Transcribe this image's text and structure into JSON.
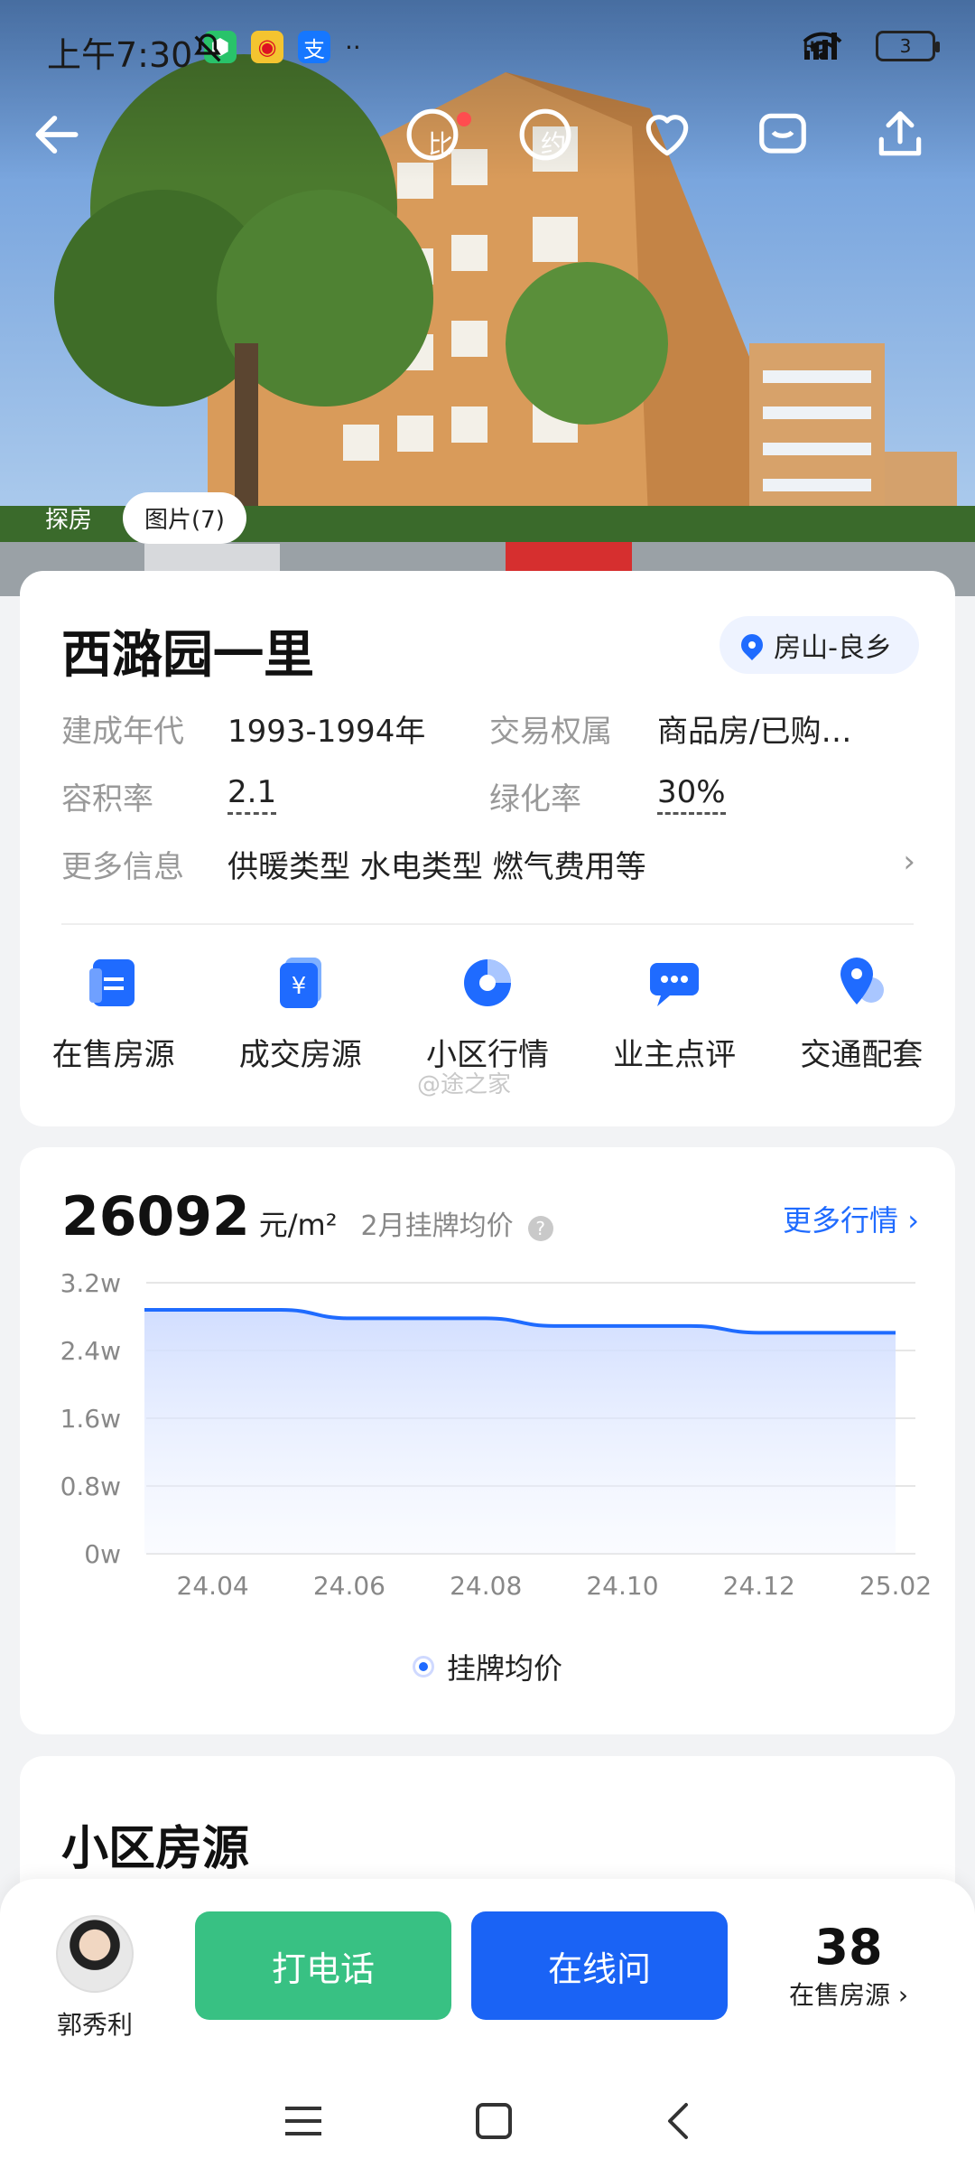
{
  "status_bar": {
    "time": "上午7:30",
    "app_icons": [
      "shield-app",
      "weibo-app",
      "alipay-app"
    ],
    "alipay_char": "支",
    "overflow": "··",
    "network": "HD",
    "battery": "3"
  },
  "photo": {
    "tabs": [
      "探房",
      "图片(7)"
    ]
  },
  "nav": {
    "icons": [
      "back-arrow-icon",
      "compare-icon",
      "calendar-icon",
      "favorite-icon",
      "message-icon",
      "share-icon"
    ],
    "compare_char": "比",
    "calendar_char": "约"
  },
  "community": {
    "name": "西潞园一里",
    "location": "房山-良乡",
    "info": {
      "built_year_label": "建成年代",
      "built_year": "1993-1994年",
      "ownership_label": "交易权属",
      "ownership": "商品房/已购…",
      "plot_ratio_label": "容积率",
      "plot_ratio": "2.1",
      "green_ratio_label": "绿化率",
      "green_ratio": "30%",
      "more_label": "更多信息",
      "more_value": "供暖类型 水电类型 燃气费用等"
    },
    "quick_links": [
      "在售房源",
      "成交房源",
      "小区行情",
      "业主点评",
      "交通配套"
    ],
    "watermark": "@途之家"
  },
  "market": {
    "price": "26092",
    "unit": "元/m²",
    "desc": "2月挂牌均价",
    "more": "更多行情 ›"
  },
  "chart_data": {
    "type": "area",
    "x": [
      "24.03",
      "24.04",
      "24.05",
      "24.06",
      "24.07",
      "24.08",
      "24.09",
      "24.10",
      "24.11",
      "24.12",
      "25.01",
      "25.02"
    ],
    "x_ticks": [
      "24.04",
      "24.06",
      "24.08",
      "24.10",
      "24.12",
      "25.02"
    ],
    "series": [
      {
        "name": "挂牌均价",
        "values": [
          28800,
          28800,
          28800,
          27800,
          27800,
          27800,
          26900,
          26900,
          26900,
          26100,
          26100,
          26092
        ],
        "color": "#1f6bff"
      }
    ],
    "y_ticks": [
      "0w",
      "0.8w",
      "1.6w",
      "2.4w",
      "3.2w"
    ],
    "ylim": [
      0,
      32000
    ],
    "grid": true,
    "legend": "bottom"
  },
  "listings": {
    "title": "小区房源"
  },
  "bottom_bar": {
    "agent_name": "郭秀利",
    "call_label": "打电话",
    "chat_label": "在线问",
    "onsale_count": "38",
    "onsale_label": "在售房源 ›"
  }
}
